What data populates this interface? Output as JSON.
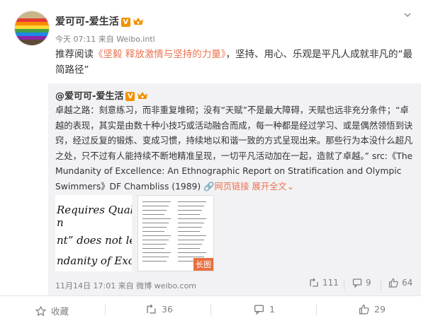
{
  "post": {
    "username": "爱可可-爱生活",
    "v_badge": "V",
    "meta": "今天 07:11 来自 Weibo.intl",
    "text_prefix": "推荐阅读",
    "text_link": "《坚毅 释放激情与坚持的力量》",
    "text_suffix": "，坚持、用心、乐观是平凡人成就非凡的“最简路径”"
  },
  "repost": {
    "username": "@爱可可-爱生活",
    "v_badge": "V",
    "text": "卓越之路：刻意练习，而非重复堆砌；没有“天赋”不是最大障碍，天赋也远非充分条件；“卓越的表现，其实是由数十种小技巧或活动融合而成，每一种都是经过学习、或是偶然领悟到诀窍，经过反复的锻炼、变成习惯，持续地以和谐一致的方式呈现出来。那些行为本没什么超凡之处，只不过有人能持续不断地精准呈现，一切平凡活动加在一起，造就了卓越。” src:《The Mundanity of Excellence: An Ethnographic Report on Stratification and Olympic Swimmers》DF Chambliss (1989) ",
    "expand_link": "网页链接",
    "expand_more": "展开全文",
    "thumb1_lines": [
      "Requires Qualit",
      "n",
      "nt” does not lead",
      "ndanity of Excell"
    ],
    "thumb2_badge": "长图",
    "footer": "11月14日 17:01 来自 微博 weibo.com",
    "forward_count": "111",
    "comment_count": "9",
    "like_count": "64"
  },
  "actions": {
    "favorite_label": "收藏",
    "forward_count": "36",
    "comment_count": "1",
    "like_count": "29"
  },
  "colors": {
    "link": "#eb7350",
    "badge": "#f29100",
    "repost_bg": "#f2f2f5"
  }
}
